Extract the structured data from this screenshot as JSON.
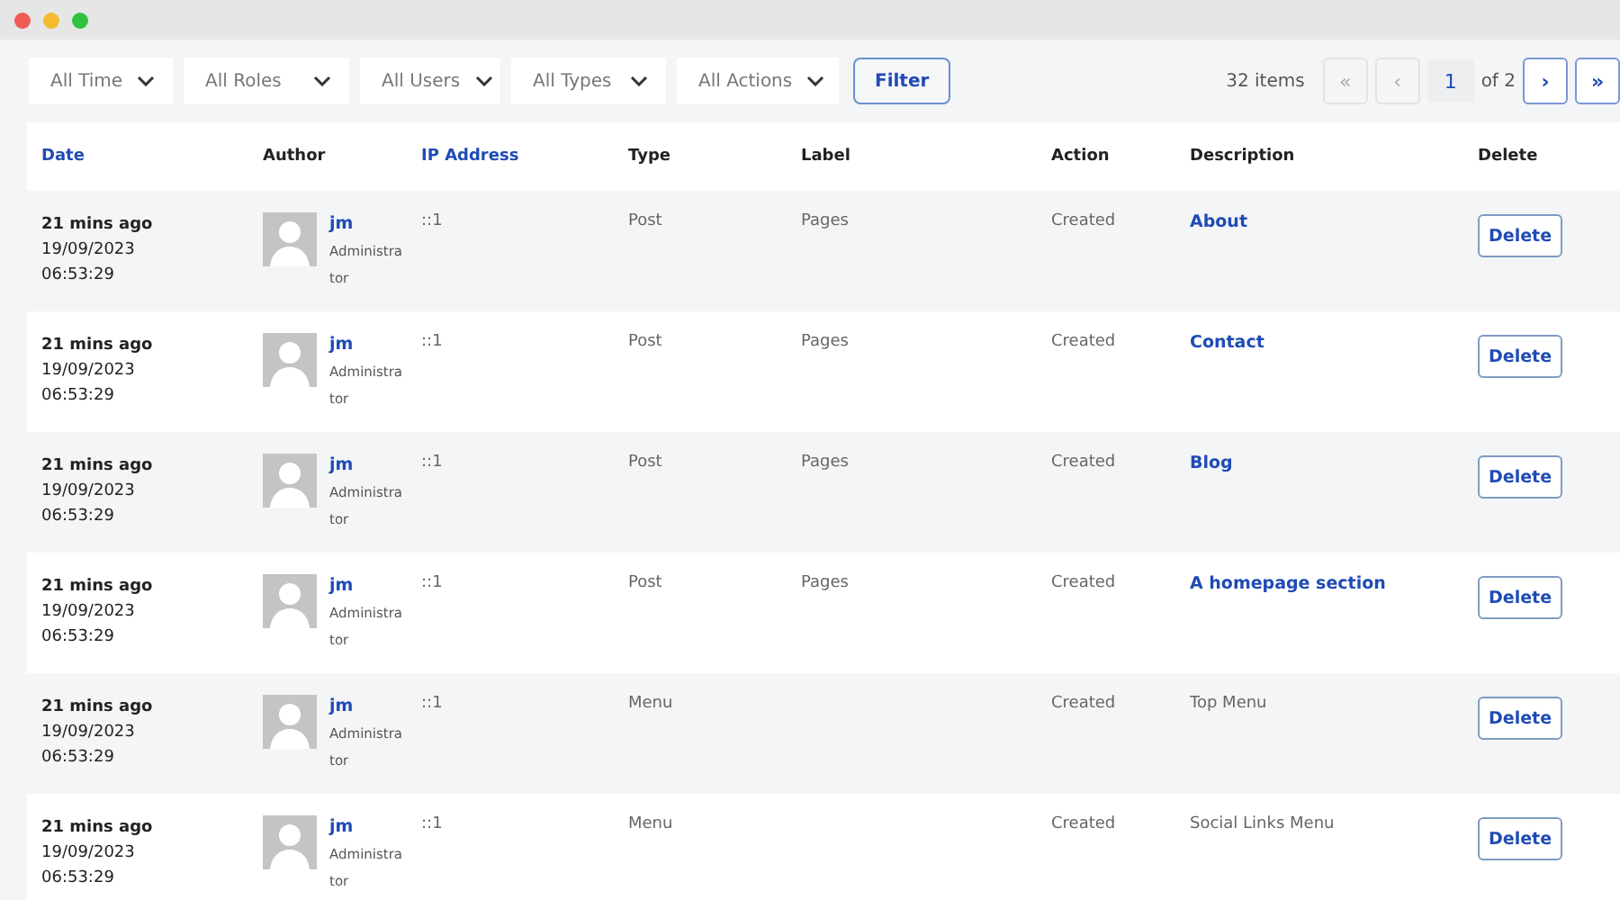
{
  "filters": [
    {
      "label": "All Time"
    },
    {
      "label": "All Roles"
    },
    {
      "label": "All Users"
    },
    {
      "label": "All Types"
    },
    {
      "label": "All Actions"
    }
  ],
  "filter_button": "Filter",
  "pagination": {
    "count": "32 items",
    "first": {
      "label": "«",
      "disabled": true
    },
    "prev": {
      "label": "‹",
      "disabled": true
    },
    "page": "1",
    "of": "of 2",
    "next": {
      "label": "›",
      "disabled": false
    },
    "last": {
      "label": "»",
      "disabled": false
    }
  },
  "table": {
    "columns": [
      {
        "label": "Date",
        "sortable": true
      },
      {
        "label": "Author",
        "sortable": false
      },
      {
        "label": "IP Address",
        "sortable": true
      },
      {
        "label": "Type",
        "sortable": false
      },
      {
        "label": "Label",
        "sortable": false
      },
      {
        "label": "Action",
        "sortable": false
      },
      {
        "label": "Description",
        "sortable": false
      },
      {
        "label": "Delete",
        "sortable": false
      }
    ],
    "rows": [
      {
        "ago": "21 mins ago",
        "date": "19/09/2023",
        "time": "06:53:29",
        "user": "jm",
        "role": "Administrator",
        "ip": "::1",
        "type": "Post",
        "label": "Pages",
        "action": "Created",
        "description": "About",
        "link": true,
        "delete": "Delete"
      },
      {
        "ago": "21 mins ago",
        "date": "19/09/2023",
        "time": "06:53:29",
        "user": "jm",
        "role": "Administrator",
        "ip": "::1",
        "type": "Post",
        "label": "Pages",
        "action": "Created",
        "description": "Contact",
        "link": true,
        "delete": "Delete"
      },
      {
        "ago": "21 mins ago",
        "date": "19/09/2023",
        "time": "06:53:29",
        "user": "jm",
        "role": "Administrator",
        "ip": "::1",
        "type": "Post",
        "label": "Pages",
        "action": "Created",
        "description": "Blog",
        "link": true,
        "delete": "Delete"
      },
      {
        "ago": "21 mins ago",
        "date": "19/09/2023",
        "time": "06:53:29",
        "user": "jm",
        "role": "Administrator",
        "ip": "::1",
        "type": "Post",
        "label": "Pages",
        "action": "Created",
        "description": "A homepage section",
        "link": true,
        "delete": "Delete"
      },
      {
        "ago": "21 mins ago",
        "date": "19/09/2023",
        "time": "06:53:29",
        "user": "jm",
        "role": "Administrator",
        "ip": "::1",
        "type": "Menu",
        "label": "",
        "action": "Created",
        "description": "Top Menu",
        "link": false,
        "delete": "Delete"
      },
      {
        "ago": "21 mins ago",
        "date": "19/09/2023",
        "time": "06:53:29",
        "user": "jm",
        "role": "Administrator",
        "ip": "::1",
        "type": "Menu",
        "label": "",
        "action": "Created",
        "description": "Social Links Menu",
        "link": false,
        "delete": "Delete"
      }
    ]
  }
}
